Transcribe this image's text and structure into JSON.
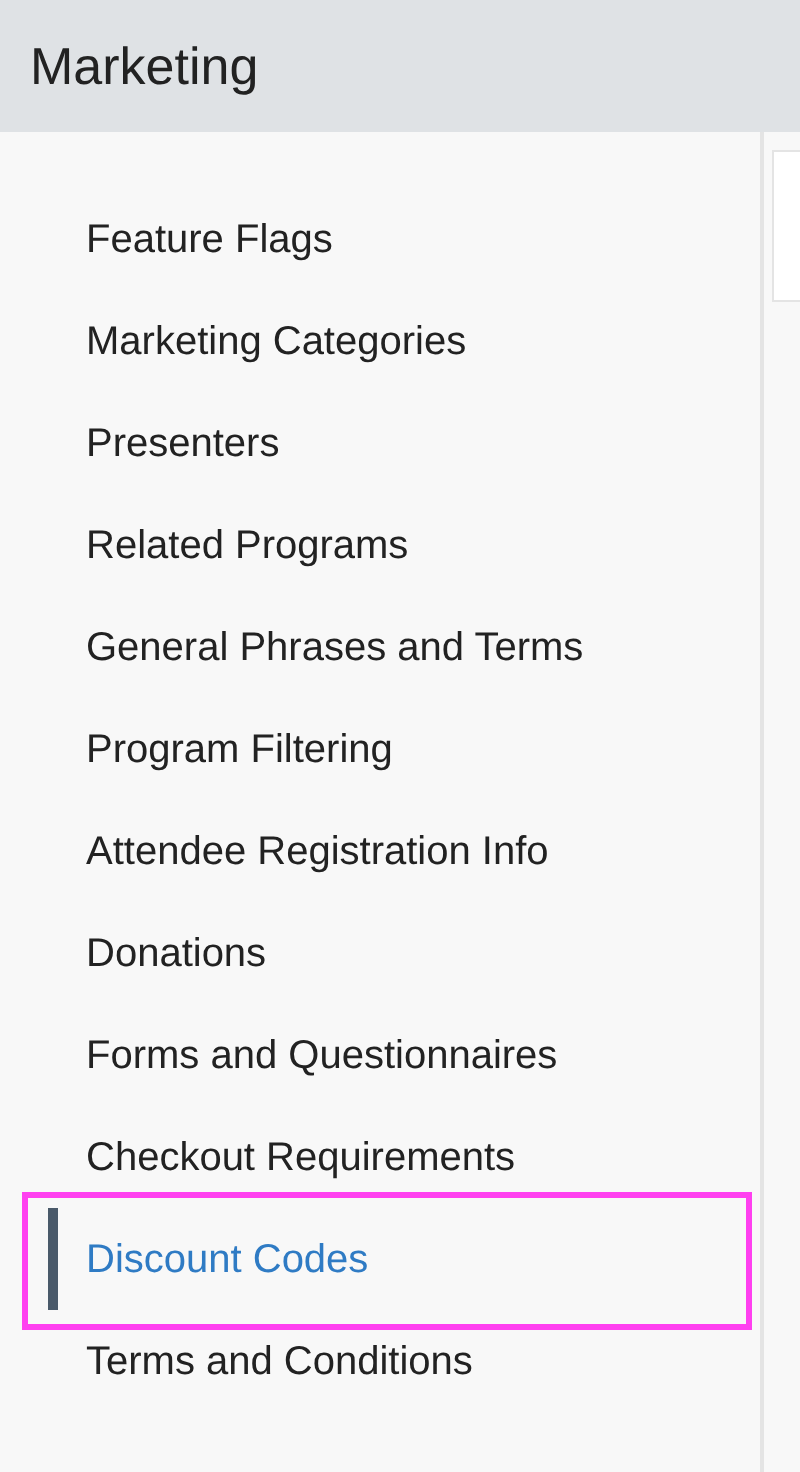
{
  "header": {
    "title": "Marketing"
  },
  "sidebar": {
    "items": [
      {
        "label": "Feature Flags",
        "selected": false
      },
      {
        "label": "Marketing Categories",
        "selected": false
      },
      {
        "label": "Presenters",
        "selected": false
      },
      {
        "label": "Related Programs",
        "selected": false
      },
      {
        "label": "General Phrases and Terms",
        "selected": false
      },
      {
        "label": "Program Filtering",
        "selected": false
      },
      {
        "label": "Attendee Registration Info",
        "selected": false
      },
      {
        "label": "Donations",
        "selected": false
      },
      {
        "label": "Forms and Questionnaires",
        "selected": false
      },
      {
        "label": "Checkout Requirements",
        "selected": false
      },
      {
        "label": "Discount Codes",
        "selected": true
      },
      {
        "label": "Terms and Conditions",
        "selected": false
      }
    ]
  }
}
